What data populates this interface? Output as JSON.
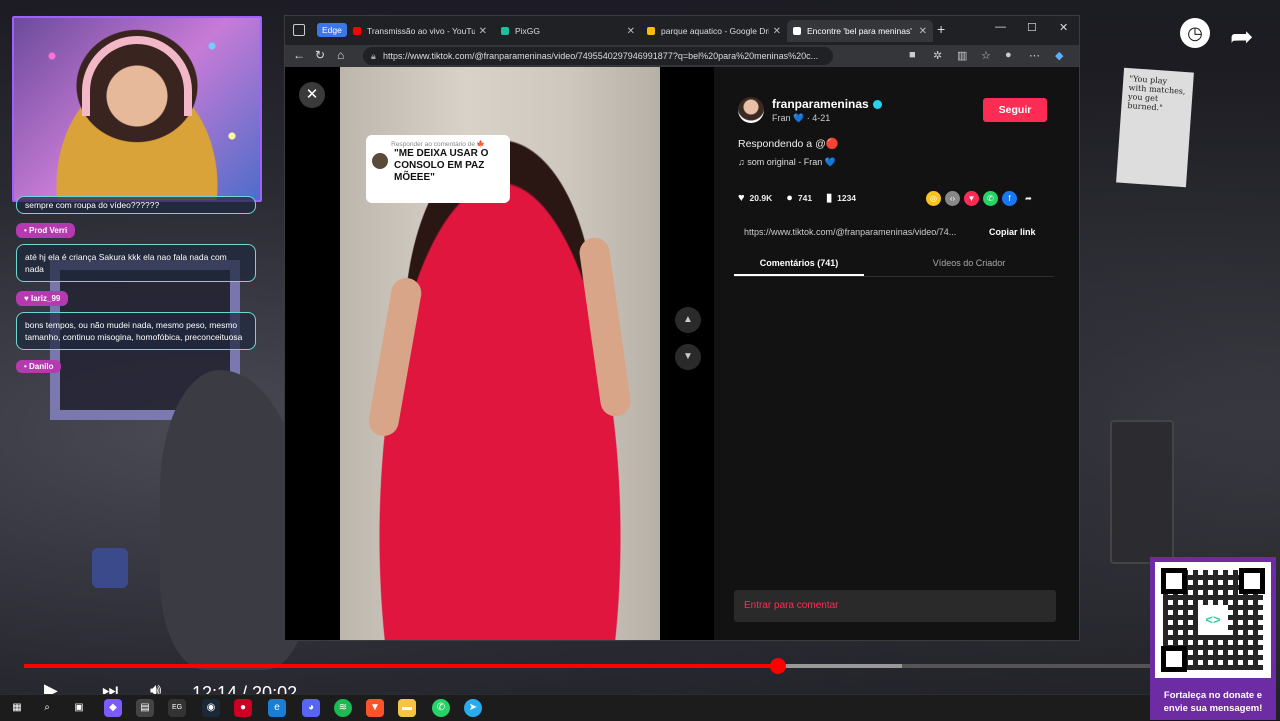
{
  "stream": {
    "chat": [
      {
        "name": "",
        "text": "sempre com roupa do vídeo??????"
      },
      {
        "name": "Prod Verri",
        "text": "até hj ela é criança Sakura kkk ela nao fala nada com nada"
      },
      {
        "name": "lariz_99",
        "text": "bons tempos, ou não mudei nada, mesmo peso, mesmo tamanho, continuo misogina, homofóbica, preconceituosa"
      },
      {
        "name": "Danilo",
        "text": ""
      }
    ],
    "poster_text": "\"You play with matches, you get burned.\"",
    "player_time": "12:14 / 20:02",
    "progress_played": 0.667,
    "progress_buffered": 0.777,
    "qr_caption": "Fortaleça no donate e envie sua mensagem!",
    "qr_mark": "<>",
    "side_icons": [
      "clock-icon",
      "share-icon"
    ]
  },
  "browser": {
    "edge_badge": "Edge",
    "tabs": [
      {
        "label": "Transmissão ao vivo - YouTube",
        "color": "#ff0000",
        "active": false
      },
      {
        "label": "PixGG",
        "color": "#18c29c",
        "active": false
      },
      {
        "label": "parque aquatico - Google Drive",
        "color": "#fbbc04",
        "active": false
      },
      {
        "label": "Encontre 'bel para meninas'",
        "color": "#ffffff",
        "active": true
      }
    ],
    "new_tab": "+",
    "window_controls": [
      "—",
      "☐",
      "✕"
    ],
    "url": "https://www.tiktok.com/@franparameninas/video/7495540297946991877?q=bel%20para%20meninas%20c..."
  },
  "tiktok": {
    "username": "franparameninas",
    "subtitle": "Fran 💙 · 4-21",
    "follow_label": "Seguir",
    "caption": "Respondendo a @🔴",
    "sound": "♫  som original - Fran 💙",
    "likes": "20.9K",
    "comments": "741",
    "saves": "1234",
    "share_link": "https://www.tiktok.com/@franparameninas/video/74...",
    "copy_label": "Copiar link",
    "tab_comments": "Comentários (741)",
    "tab_creator": "Vídeos do Criador",
    "comment_placeholder": "Entrar para comentar",
    "reply_header": "Responder ao comentário de 🍁",
    "reply_text": "\"ME DEIXA USAR O CONSOLO EM PAZ MÕEEE\"",
    "share_colors": [
      "#f5c518",
      "#888888",
      "#fe2c55",
      "#25d366",
      "#1877f2"
    ]
  },
  "taskbar": [
    "start-icon",
    "search-icon",
    "task-view-icon",
    "copilot-icon",
    "store-icon",
    "epic-icon",
    "steam-icon",
    "app-icon",
    "edge-icon",
    "discord-icon",
    "spotify-icon",
    "brave-icon",
    "files-icon",
    "whatsapp-icon",
    "telegram-icon"
  ]
}
